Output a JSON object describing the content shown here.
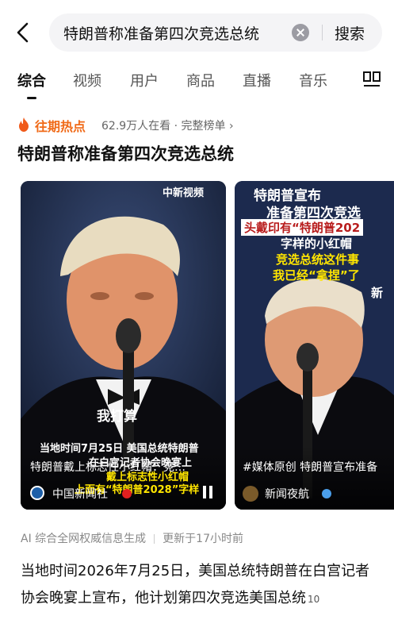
{
  "search": {
    "query": "特朗普称准备第四次竞选总统",
    "button": "搜索"
  },
  "tabs": [
    {
      "label": "综合"
    },
    {
      "label": "视频"
    },
    {
      "label": "用户"
    },
    {
      "label": "商品"
    },
    {
      "label": "直播"
    },
    {
      "label": "音乐"
    }
  ],
  "hot": {
    "label": "往期热点",
    "meta": "62.9万人在看 · 完整榜单 ›"
  },
  "result_title": "特朗普称准备第四次竞选总统",
  "video1": {
    "logo_text": "中新视频",
    "subtitle": "我打算",
    "caption_line1": "当地时间7月25日 美国总统特朗普",
    "caption_line2": "在白宫记者协会晚宴上",
    "caption_line3": "戴上标志性小红帽",
    "caption_line4": "上面有“特朗普2028”字样",
    "title": "特朗普戴上标志性小红帽：竞…",
    "source": "中国新闻社"
  },
  "video2": {
    "overlay_line1": "特朗普宣布",
    "overlay_line2": "准备第四次竞选",
    "overlay_line3": "头戴印有“特朗普202",
    "overlay_line4": "字样的小红帽",
    "overlay_line5": "竞选总统这件事",
    "overlay_line6": "我已经“拿捏”了",
    "corner": "新",
    "title": "#媒体原创 特朗普宣布准备",
    "source": "新闻夜航"
  },
  "ai_note": {
    "source": "AI 综合全网权威信息生成",
    "updated": "更新于17小时前"
  },
  "summary": "当地时间2026年7月25日，美国总统特朗普在白宫记者协会晚宴上宣布，他计划第四次竞选美国总统",
  "summary_ref": "10",
  "colors": {
    "accent": "#f06a18",
    "brand_red": "#e02020",
    "caption_yellow": "#ffe500"
  }
}
